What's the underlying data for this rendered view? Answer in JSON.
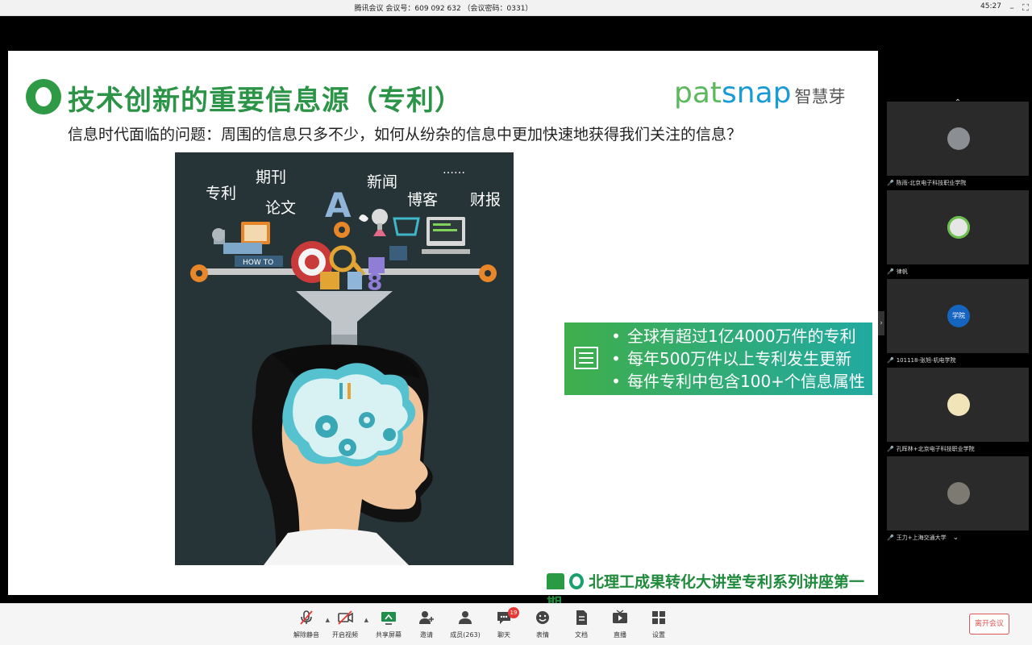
{
  "window": {
    "title": "腾讯会议 会议号：609 092 632 （会议密码：0331）",
    "time": "45:27"
  },
  "slide": {
    "title": "技术创新的重要信息源（专利）",
    "logo_en_a": "pat",
    "logo_en_b": "snap",
    "logo_cn": "智慧芽",
    "subtitle": "信息时代面临的问题：周围的信息只多不少，如何从纷杂的信息中更加快速地获得我们关注的信息？",
    "illustration_labels": [
      "专利",
      "期刊",
      "论文",
      "新闻",
      "……",
      "博客",
      "财报"
    ],
    "how_to": "HOW TO",
    "info_points": [
      "全球有超过1亿4000万件的专利",
      "每年500万件以上专利发生更新",
      "每件专利中包含100+个信息属性"
    ],
    "footer": "北理工成果转化大讲堂专利系列讲座第一期",
    "colors": {
      "title_green": "#2c9447",
      "box_start": "#3fae4c",
      "box_end": "#22a9a0",
      "illus_bg": "#263337"
    }
  },
  "participants": [
    {
      "name": "陈雨-北京电子科技职业学院"
    },
    {
      "name": "律帆"
    },
    {
      "name": "101118-张旭-机电学院",
      "avatar_text": "学院"
    },
    {
      "name": "孔晖林+北京电子科技职业学院"
    },
    {
      "name": "王力+上海交通大学"
    }
  ],
  "toolbar": {
    "items": [
      {
        "label": "解除静音",
        "icon": "mic-off-icon"
      },
      {
        "label": "开启视频",
        "icon": "camera-off-icon"
      },
      {
        "label": "共享屏幕",
        "icon": "share-screen-icon"
      },
      {
        "label": "邀请",
        "icon": "invite-icon"
      },
      {
        "label": "成员(263)",
        "icon": "members-icon"
      },
      {
        "label": "聊天",
        "icon": "chat-icon",
        "badge": "19"
      },
      {
        "label": "表情",
        "icon": "emoji-icon"
      },
      {
        "label": "文档",
        "icon": "document-icon"
      },
      {
        "label": "直播",
        "icon": "live-icon"
      },
      {
        "label": "设置",
        "icon": "settings-icon"
      }
    ],
    "leave": "离开会议"
  }
}
